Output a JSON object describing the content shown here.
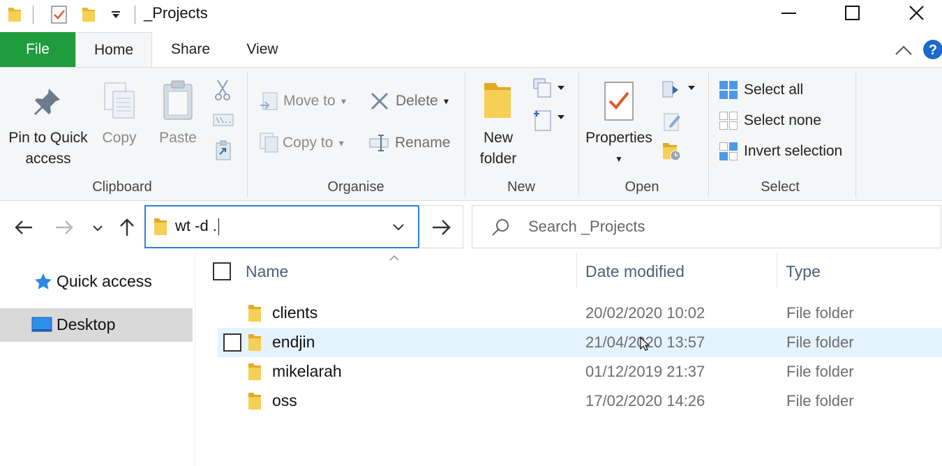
{
  "window": {
    "title": "_Projects"
  },
  "tabs": {
    "file": "File",
    "home": "Home",
    "share": "Share",
    "view": "View"
  },
  "ribbon": {
    "clipboard": {
      "label": "Clipboard",
      "pin_line1": "Pin to Quick",
      "pin_line2": "access",
      "copy": "Copy",
      "paste": "Paste"
    },
    "organise": {
      "label": "Organise",
      "move_to": "Move to",
      "copy_to": "Copy to",
      "delete": "Delete",
      "rename": "Rename"
    },
    "new": {
      "label": "New",
      "new_folder_line1": "New",
      "new_folder_line2": "folder"
    },
    "open": {
      "label": "Open",
      "properties": "Properties"
    },
    "select": {
      "label": "Select",
      "select_all": "Select all",
      "select_none": "Select none",
      "invert": "Invert selection"
    }
  },
  "address": {
    "value": "wt -d ."
  },
  "search": {
    "placeholder": "Search _Projects"
  },
  "nav": {
    "quick_access": "Quick access",
    "desktop": "Desktop"
  },
  "columns": {
    "name": "Name",
    "date": "Date modified",
    "type": "Type"
  },
  "files": [
    {
      "name": "clients",
      "date": "20/02/2020 10:02",
      "type": "File folder"
    },
    {
      "name": "endjin",
      "date": "21/04/2020 13:57",
      "type": "File folder"
    },
    {
      "name": "mikelarah",
      "date": "01/12/2019 21:37",
      "type": "File folder"
    },
    {
      "name": "oss",
      "date": "17/02/2020 14:26",
      "type": "File folder"
    }
  ],
  "colors": {
    "file_tab": "#1f9c3e",
    "address_focus": "#2f7fd4",
    "row_hover": "#e5f3ff",
    "folder": "#f4c542"
  }
}
